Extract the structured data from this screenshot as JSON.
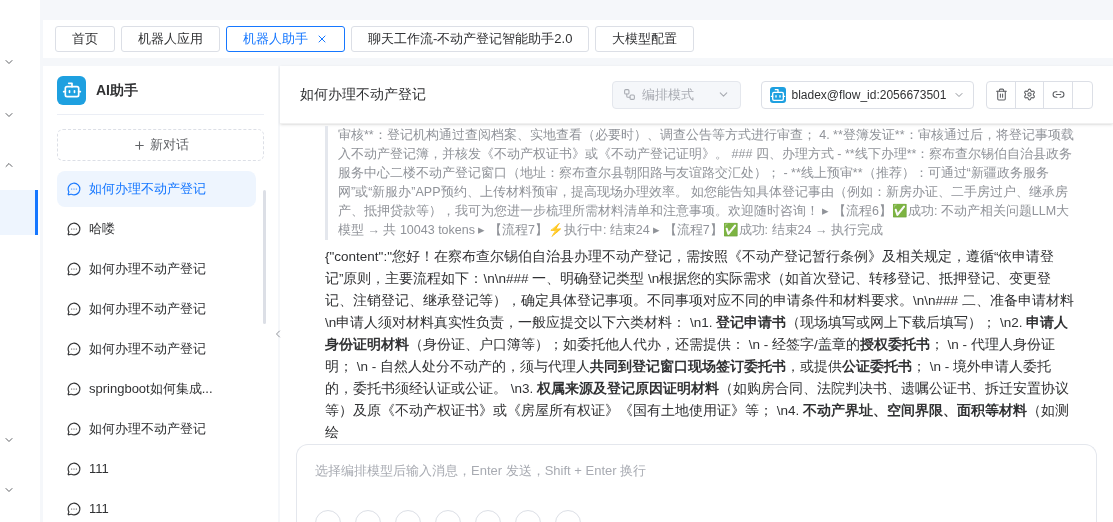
{
  "tabs": [
    {
      "label": "首页",
      "selected": false,
      "closable": false
    },
    {
      "label": "机器人应用",
      "selected": false,
      "closable": false
    },
    {
      "label": "机器人助手",
      "selected": true,
      "closable": true
    },
    {
      "label": "聊天工作流-不动产登记智能助手2.0",
      "selected": false,
      "closable": false
    },
    {
      "label": "大模型配置",
      "selected": false,
      "closable": false
    }
  ],
  "sidebar": {
    "title": "AI助手",
    "new_chat": "新对话",
    "items": [
      {
        "label": "如何办理不动产登记",
        "selected": true
      },
      {
        "label": "哈喽",
        "selected": false
      },
      {
        "label": "如何办理不动产登记",
        "selected": false
      },
      {
        "label": "如何办理不动产登记",
        "selected": false
      },
      {
        "label": "如何办理不动产登记",
        "selected": false
      },
      {
        "label": "springboot如何集成...",
        "selected": false
      },
      {
        "label": "如何办理不动产登记",
        "selected": false
      },
      {
        "label": "111",
        "selected": false
      },
      {
        "label": "111",
        "selected": false
      }
    ]
  },
  "chat": {
    "title": "如何办理不动产登记",
    "mode_select": {
      "placeholder": "编排模式",
      "disabled": true
    },
    "model_select": {
      "value": "bladex@flow_id:2056673501"
    },
    "log": "审核**：登记机构通过查阅档案、实地查看（必要时）、调查公告等方式进行审查； 4. **登簿发证**：审核通过后，将登记事项载入不动产登记簿，并核发《不动产权证书》或《不动产登记证明》。 ### 四、办理方式 - **线下办理**：察布查尔锡伯自治县政务服务中心二楼不动产登记窗口（地址：察布查尔县朝阳路与友谊路交汇处）； - **线上预审**（推荐）：可通过“新疆政务服务网”或“新服办”APP预约、上传材料预审，提高现场办理效率。 如您能告知具体登记事由（例如：新房办证、二手房过户、继承房产、抵押贷款等），我可为您进一步梳理所需材料清单和注意事项。欢迎随时咨询！ ▸ 【流程6】✅成功: 不动产相关问题LLM大模型 → 共 10043 tokens ▸ 【流程7】⚡执行中: 结束24 ▸ 【流程7】✅成功: 结束24 → 执行完成",
    "answer": "{\"content\":\"您好！在察布查尔锡伯自治县办理不动产登记，需按照《不动产登记暂行条例》及相关规定，遵循“依申请登记”原则，主要流程如下：\\n\\n### 一、明确登记类型 \\n根据您的实际需求（如首次登记、转移登记、抵押登记、变更登记、注销登记、继承登记等），确定具体登记事项。不同事项对应不同的申请条件和材料要求。\\n\\n### 二、准备申请材料 \\n申请人须对材料真实性负责，一般应提交以下六类材料： \\n1. **登记申请书**（现场填写或网上下载后填写）； \\n2. **申请人身份证明材料**（身份证、户口簿等）；如委托他人代办，还需提供： \\n   - 经签字/盖章的**授权委托书**； \\n   - 代理人身份证明； \\n   - 自然人处分不动产的，须与代理人**共同到登记窗口现场签订委托书**，或提供**公证委托书**； \\n   - 境外申请人委托的，委托书须经认证或公证。 \\n3. **权属来源及登记原因证明材料**（如购房合同、法院判决书、遗嘱公证书、拆迁安置协议等）及原《不动产权证书》或《房屋所有权证》《国有土地使用证》等； \\n4. **不动产界址、空间界限、面积等材料**（如测绘",
    "input": {
      "placeholder": "选择编排模型后输入消息，Enter 发送，Shift + Enter 换行"
    }
  }
}
